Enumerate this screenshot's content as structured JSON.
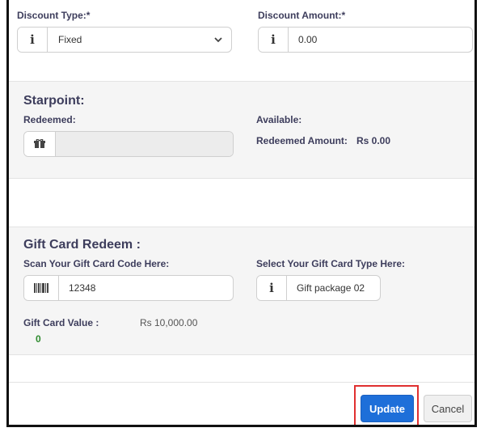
{
  "discount": {
    "type_label": "Discount Type:*",
    "type_value": "Fixed",
    "amount_label": "Discount Amount:*",
    "amount_value": "0.00",
    "info_glyph": "i"
  },
  "starpoint": {
    "title": "Starpoint:",
    "redeemed_label": "Redeemed:",
    "redeemed_value": "",
    "available_label": "Available:",
    "redeemed_amount_label": "Redeemed Amount:",
    "redeemed_amount_value": "Rs 0.00"
  },
  "gift_card": {
    "title": "Gift Card Redeem :",
    "scan_label": "Scan Your Gift Card Code Here:",
    "scan_value": "12348",
    "type_label": "Select Your Gift Card Type Here:",
    "type_value": "Gift package 02",
    "value_label": "Gift Card Value :",
    "value_amount": "Rs 10,000.00",
    "count": "0",
    "info_glyph": "i"
  },
  "footer": {
    "update_label": "Update",
    "cancel_label": "Cancel"
  },
  "icons": [
    "info-icon",
    "chevron-down-icon",
    "gift-icon",
    "barcode-icon"
  ],
  "colors": {
    "primary": "#1e6fd9",
    "highlight": "#e03030",
    "count_green": "#2e8b2e",
    "band_grey": "#f5f5f5"
  }
}
